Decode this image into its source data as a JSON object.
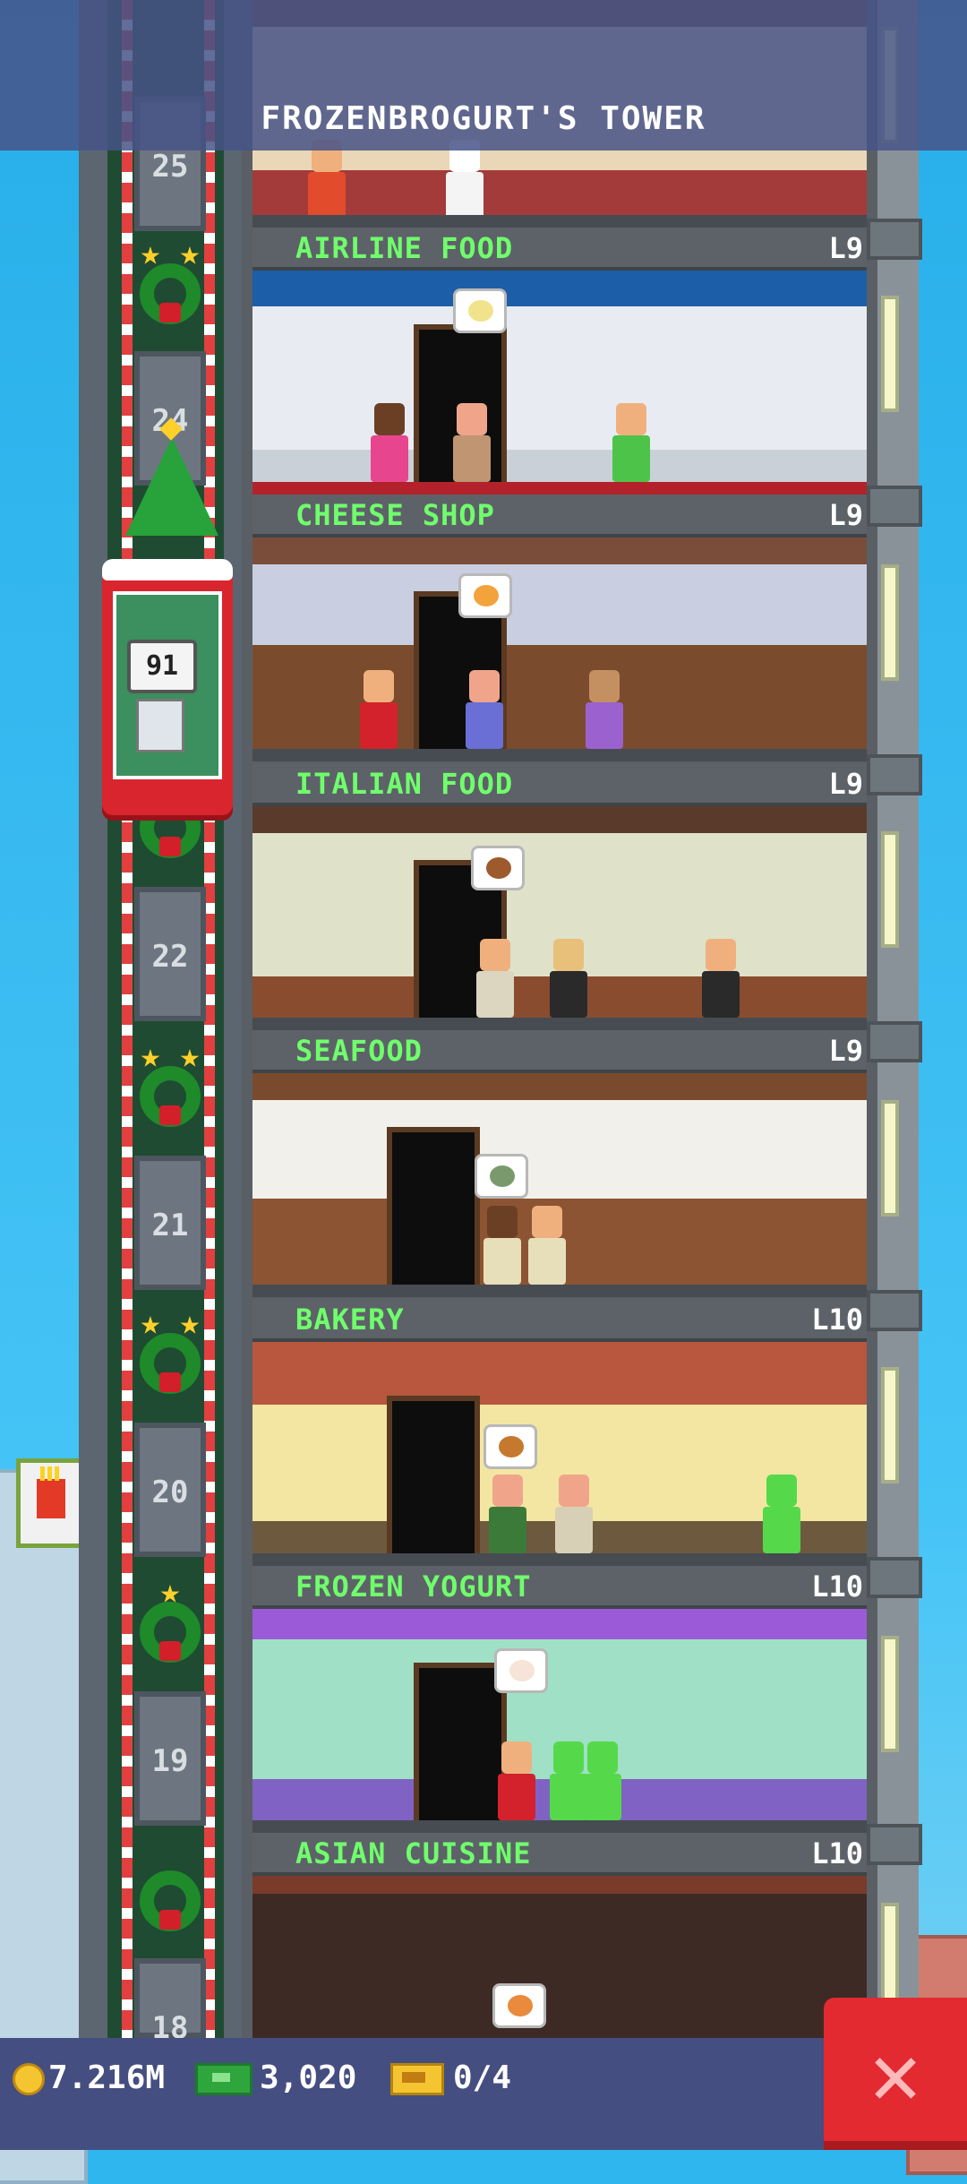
{
  "tower": {
    "title": "FROZENBROGURT'S TOWER"
  },
  "elevator": {
    "counter": "91"
  },
  "shaft_floor_numbers": [
    "25",
    "24",
    "22",
    "21",
    "20",
    "19",
    "18"
  ],
  "floors": [
    {
      "name": "AIRLINE FOOD",
      "level": "L9"
    },
    {
      "name": "CHEESE SHOP",
      "level": "L9"
    },
    {
      "name": "ITALIAN FOOD",
      "level": "L9"
    },
    {
      "name": "SEAFOOD",
      "level": "L9"
    },
    {
      "name": "BAKERY",
      "level": "L10"
    },
    {
      "name": "FROZEN YOGURT",
      "level": "L10"
    },
    {
      "name": "ASIAN CUISINE",
      "level": "L10"
    }
  ],
  "resources": {
    "coins": "7.216M",
    "bux": "3,020",
    "tickets": "0/4"
  },
  "colors": {
    "sky": "#2fb6ee",
    "floor_name": "#70ff6c",
    "elevator": "#d9252d",
    "bottom_bar": "#454e80",
    "close_button": "#e32a30"
  },
  "icons": {
    "coin": "coin-icon",
    "bux": "bux-icon",
    "ticket": "ticket-icon",
    "close": "close-icon"
  }
}
